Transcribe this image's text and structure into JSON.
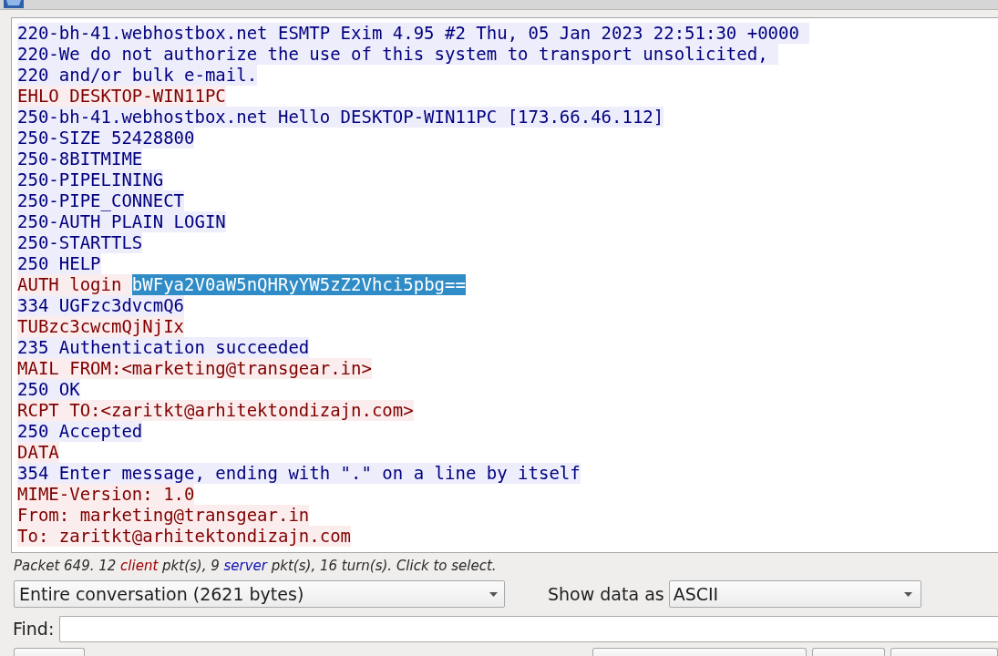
{
  "stream": {
    "lines": [
      {
        "kind": "server",
        "text": "220-bh-41.webhostbox.net ESMTP Exim 4.95 #2 Thu, 05 Jan 2023 22:51:30 +0000 "
      },
      {
        "kind": "server",
        "text": "220-We do not authorize the use of this system to transport unsolicited, "
      },
      {
        "kind": "server",
        "text": "220 and/or bulk e-mail."
      },
      {
        "kind": "client",
        "text": "EHLO DESKTOP-WIN11PC"
      },
      {
        "kind": "server",
        "text": "250-bh-41.webhostbox.net Hello DESKTOP-WIN11PC [173.66.46.112]"
      },
      {
        "kind": "server",
        "text": "250-SIZE 52428800"
      },
      {
        "kind": "server",
        "text": "250-8BITMIME"
      },
      {
        "kind": "server",
        "text": "250-PIPELINING"
      },
      {
        "kind": "server",
        "text": "250-PIPE_CONNECT"
      },
      {
        "kind": "server",
        "text": "250-AUTH PLAIN LOGIN"
      },
      {
        "kind": "server",
        "text": "250-STARTTLS"
      },
      {
        "kind": "server",
        "text": "250 HELP"
      },
      {
        "kind": "client",
        "parts": [
          {
            "text": "AUTH login ",
            "selected": false
          },
          {
            "text": "bWFya2V0aW5nQHRyYW5zZ2Vhci5pbg==",
            "selected": true
          }
        ]
      },
      {
        "kind": "server",
        "text": "334 UGFzc3dvcmQ6"
      },
      {
        "kind": "client",
        "text": "TUBzc3cwcmQjNjIx"
      },
      {
        "kind": "server",
        "text": "235 Authentication succeeded"
      },
      {
        "kind": "client",
        "text": "MAIL FROM:<marketing@transgear.in>"
      },
      {
        "kind": "server",
        "text": "250 OK"
      },
      {
        "kind": "client",
        "text": "RCPT TO:<zaritkt@arhitektondizajn.com>"
      },
      {
        "kind": "server",
        "text": "250 Accepted"
      },
      {
        "kind": "client",
        "text": "DATA"
      },
      {
        "kind": "server",
        "text": "354 Enter message, ending with \".\" on a line by itself"
      },
      {
        "kind": "client",
        "text": "MIME-Version: 1.0"
      },
      {
        "kind": "client",
        "text": "From: marketing@transgear.in"
      },
      {
        "kind": "client",
        "text": "To: zaritkt@arhitektondizajn.com"
      }
    ]
  },
  "status": {
    "parts": [
      {
        "kind": "plain",
        "text": "Packet 649. 12 "
      },
      {
        "kind": "client",
        "text": "client"
      },
      {
        "kind": "plain",
        "text": " pkt(s), 9 "
      },
      {
        "kind": "server",
        "text": "server"
      },
      {
        "kind": "plain",
        "text": " pkt(s), 16 turn(s). Click to select."
      }
    ]
  },
  "conversation_select": {
    "value": "Entire conversation (2621 bytes)"
  },
  "show_data_as": {
    "label": "Show data as",
    "value": "ASCII"
  },
  "find": {
    "label": "Find:"
  }
}
